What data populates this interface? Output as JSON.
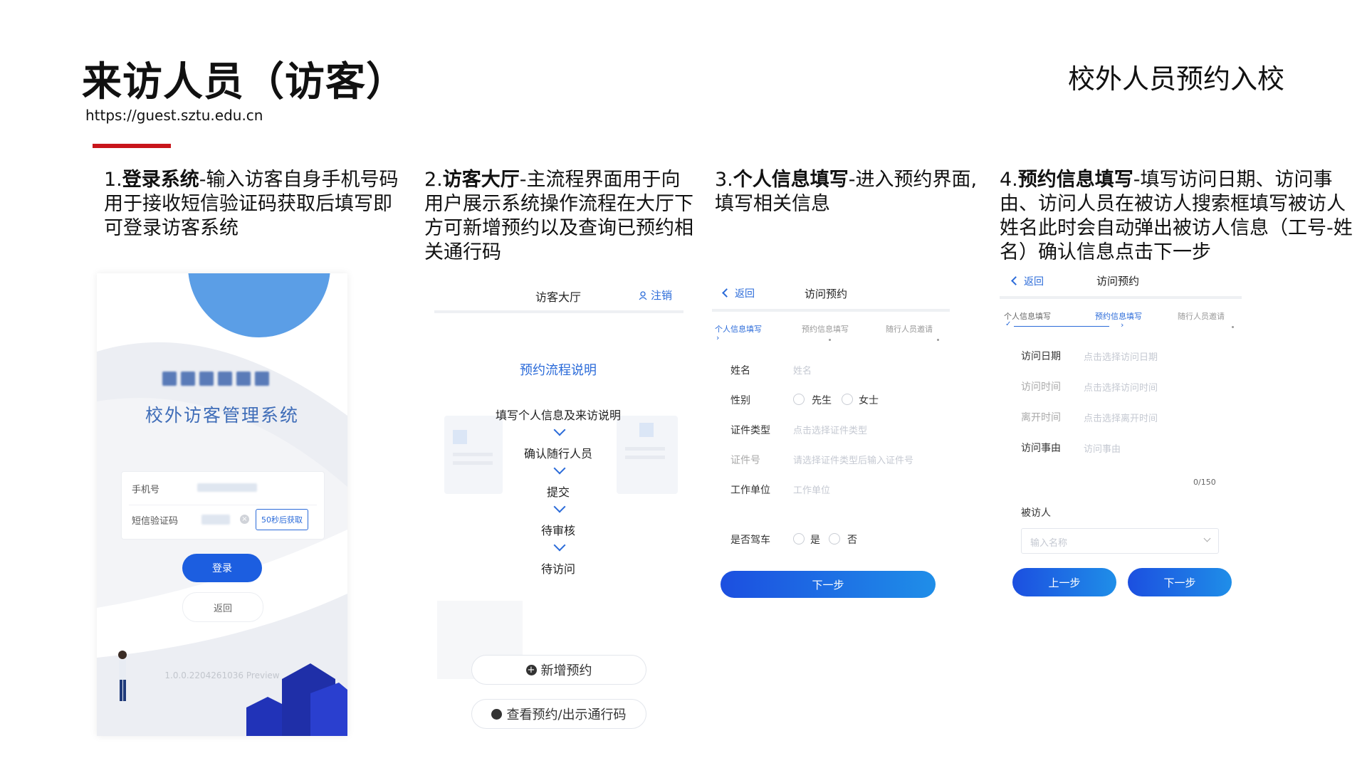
{
  "header": {
    "title": "来访人员（访客）",
    "url": "https://guest.sztu.edu.cn",
    "subtitle": "校外人员预约入校"
  },
  "colors": {
    "accent_red": "#c8151b",
    "primary_blue": "#2b6bd9"
  },
  "steps": [
    {
      "num": "1.",
      "name": "登录系统",
      "desc": "-输入访客自身手机号码用于接收短信验证码获取后填写即可登录访客系统"
    },
    {
      "num": "2.",
      "name": "访客大厅",
      "desc": "-主流程界面用于向用户展示系统操作流程在大厅下方可新增预约以及查询已预约相关通行码"
    },
    {
      "num": "3.",
      "name": "个人信息填写",
      "desc": "-进入预约界面,填写相关信息"
    },
    {
      "num": "4.",
      "name": "预约信息填写",
      "desc": "-填写访问日期、访问事由、访问人员在被访人搜索框填写被访人姓名此时会自动弹出被访人信息（工号-姓名）确认信息点击下一步"
    }
  ],
  "login": {
    "system_name": "校外访客管理系统",
    "phone_label": "手机号",
    "sms_label": "短信验证码",
    "resend_button": "50秒后获取",
    "login_button": "登录",
    "back_button": "返回",
    "version": "1.0.0.2204261036 Preview"
  },
  "hall": {
    "title": "访客大厅",
    "logout": "注销",
    "section_title": "预约流程说明",
    "flow": [
      "填写个人信息及来访说明",
      "确认随行人员",
      "提交",
      "待审核",
      "待访问"
    ],
    "new_button": "新增预约",
    "view_button": "查看预约/出示通行码"
  },
  "personal": {
    "back": "返回",
    "title": "访问预约",
    "tabs": [
      "个人信息填写",
      "预约信息填写",
      "随行人员邀请"
    ],
    "fields": {
      "name_label": "姓名",
      "name_ph": "姓名",
      "gender_label": "性别",
      "male": "先生",
      "female": "女士",
      "idtype_label": "证件类型",
      "idtype_ph": "点击选择证件类型",
      "idno_label": "证件号",
      "idno_ph": "请选择证件类型后输入证件号",
      "work_label": "工作单位",
      "work_ph": "工作单位",
      "drive_label": "是否驾车",
      "yes": "是",
      "no": "否"
    },
    "next_button": "下一步"
  },
  "booking": {
    "back": "返回",
    "title": "访问预约",
    "tabs": [
      "个人信息填写",
      "预约信息填写",
      "随行人员邀请"
    ],
    "fields": {
      "date_label": "访问日期",
      "date_ph": "点击选择访问日期",
      "time_label": "访问时间",
      "time_ph": "点击选择访问时间",
      "leave_label": "离开时间",
      "leave_ph": "点击选择离开时间",
      "reason_label": "访问事由",
      "reason_ph": "访问事由",
      "counter": "0/150",
      "host_label": "被访人",
      "host_ph": "输入名称"
    },
    "prev_button": "上一步",
    "next_button": "下一步"
  }
}
